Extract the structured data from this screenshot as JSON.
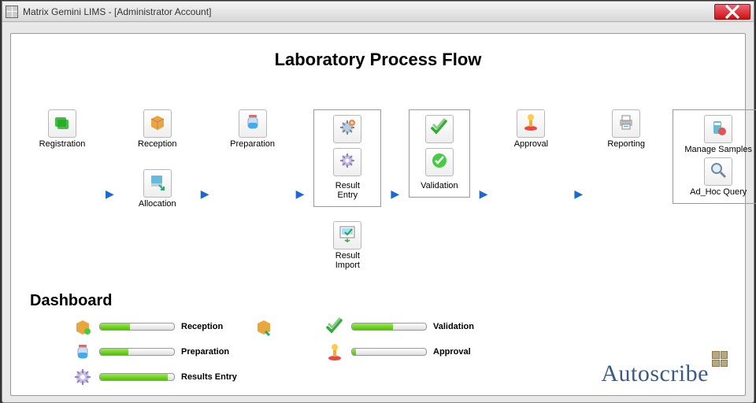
{
  "window": {
    "title": "Matrix Gemini LIMS - [Administrator Account]"
  },
  "page": {
    "title": "Laboratory Process Flow"
  },
  "flow": {
    "registration": "Registration",
    "reception": "Reception",
    "allocation": "Allocation",
    "preparation": "Preparation",
    "result_entry": "Result Entry",
    "result_import": "Result\nImport",
    "validation": "Validation",
    "approval": "Approval",
    "reporting": "Reporting",
    "manage_samples": "Manage Samples",
    "adhoc_query": "Ad_Hoc Query"
  },
  "dashboard": {
    "title": "Dashboard",
    "reception": "Reception",
    "preparation": "Preparation",
    "results_entry": "Results Entry",
    "validation": "Validation",
    "approval": "Approval"
  },
  "brand": "Autoscribe"
}
